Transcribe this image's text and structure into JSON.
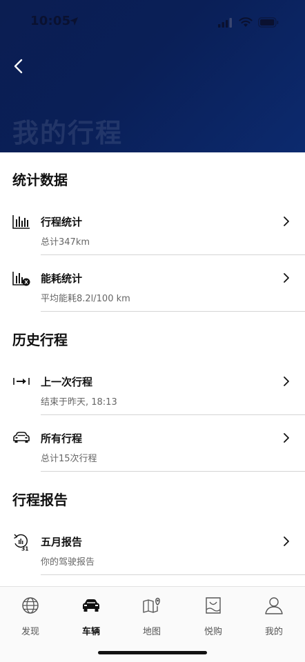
{
  "status_bar": {
    "time": "10:05"
  },
  "header": {
    "title": "我的行程"
  },
  "sections": [
    {
      "title": "统计数据",
      "items": [
        {
          "icon": "bar-chart-icon",
          "title": "行程统计",
          "subtitle": "总计347km"
        },
        {
          "icon": "energy-chart-icon",
          "title": "能耗统计",
          "subtitle": "平均能耗8.2l/100 km"
        }
      ]
    },
    {
      "title": "历史行程",
      "items": [
        {
          "icon": "last-trip-arrow-icon",
          "title": "上一次行程",
          "subtitle": "结束于昨天, 18:13"
        },
        {
          "icon": "car-icon",
          "title": "所有行程",
          "subtitle": "总计15次行程"
        }
      ]
    },
    {
      "title": "行程报告",
      "items": [
        {
          "icon": "monthly-report-icon",
          "title": "五月报告",
          "subtitle": "你的驾驶报告"
        }
      ]
    }
  ],
  "tab_bar": {
    "tabs": [
      {
        "label": "发现",
        "icon": "globe-icon"
      },
      {
        "label": "车辆",
        "icon": "car-icon",
        "active": true
      },
      {
        "label": "地图",
        "icon": "map-icon"
      },
      {
        "label": "悦购",
        "icon": "shopping-bag-icon"
      },
      {
        "label": "我的",
        "icon": "person-icon"
      }
    ]
  },
  "colors": {
    "header_bg": "#0a1f57",
    "divider": "#d4d4d4",
    "subtitle": "#666666"
  }
}
